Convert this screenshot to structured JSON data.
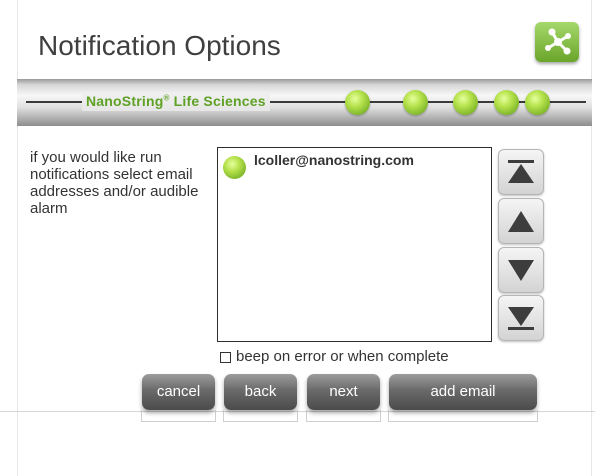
{
  "header": {
    "title": "Notification Options",
    "action_icon": "network-icon"
  },
  "banner": {
    "brand": "NanoString",
    "reg_mark": "®",
    "suffix": " Life Sciences",
    "progress_dots": 5,
    "accent": "#6aa52b"
  },
  "instructions": "if you would like run notifications select email addresses and/or audible alarm",
  "email_list": {
    "items": [
      {
        "label": "lcoller@nanostring.com",
        "icon": "green-status-dot"
      }
    ]
  },
  "scroll_buttons": [
    {
      "icon": "scroll-top-icon"
    },
    {
      "icon": "scroll-up-icon"
    },
    {
      "icon": "scroll-down-icon"
    },
    {
      "icon": "scroll-bottom-icon"
    }
  ],
  "beep_option": {
    "label": "beep on error or when complete",
    "checked": false
  },
  "buttons": {
    "cancel": "cancel",
    "back": "back",
    "next": "next",
    "add_email": "add email"
  }
}
